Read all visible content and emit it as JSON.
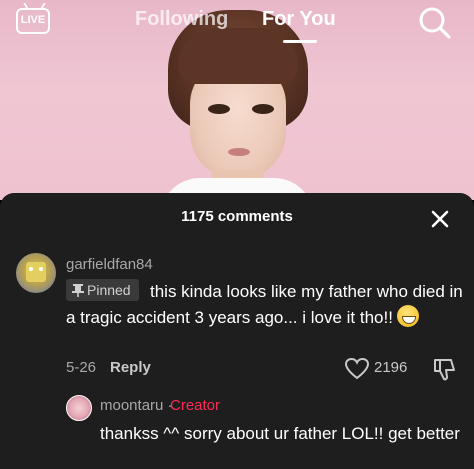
{
  "header": {
    "live_label": "LIVE",
    "tabs": [
      {
        "label": "Following",
        "active": false
      },
      {
        "label": "For You",
        "active": true
      }
    ]
  },
  "comments_panel": {
    "title": "1175 comments",
    "comments": [
      {
        "username": "garfieldfan84",
        "pinned_label": "Pinned",
        "text": "this kinda looks like my father who died in a tragic accident 3 years ago... i love it tho!!",
        "emoji": "grinning-face",
        "date": "5-26",
        "reply_label": "Reply",
        "likes": "2196"
      }
    ],
    "replies": [
      {
        "username": "moontaru",
        "separator": "·",
        "role_label": "Creator",
        "text": "thankss ^^ sorry about ur father LOL!! get better"
      }
    ]
  },
  "colors": {
    "sheet_background": "#1e1e1e",
    "creator_accent": "#fe2c55",
    "video_background": "#f0c6d3"
  }
}
